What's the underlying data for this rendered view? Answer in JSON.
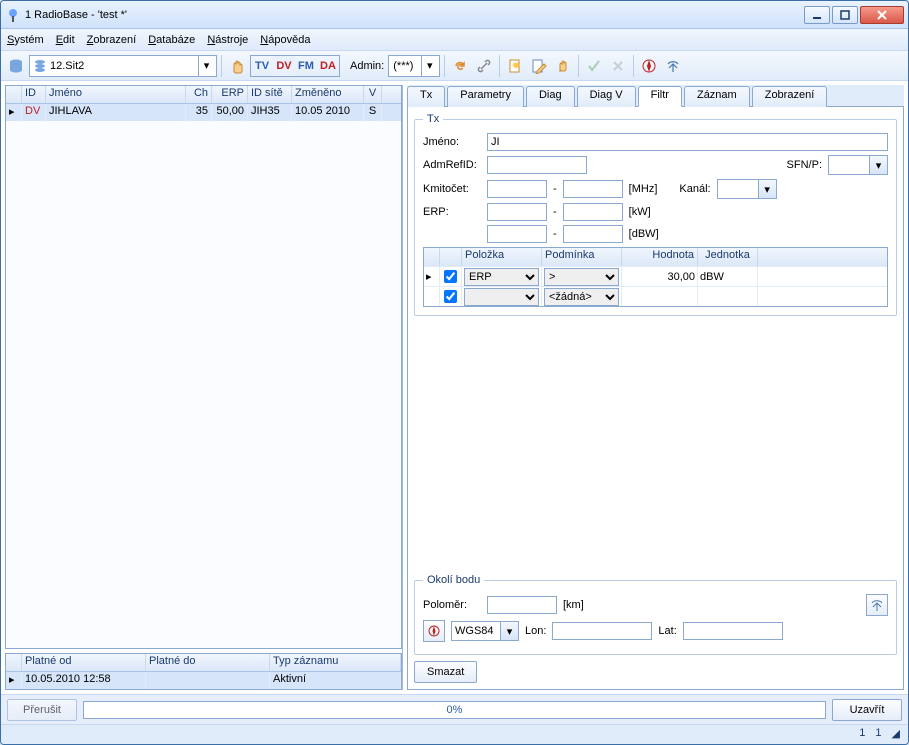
{
  "window": {
    "title": "1 RadioBase - 'test *'"
  },
  "menu": {
    "items": [
      "Systém",
      "Edit",
      "Zobrazení",
      "Databáze",
      "Nástroje",
      "Nápověda"
    ]
  },
  "toolbar": {
    "net_combo": "12.Sit2",
    "modes": {
      "tv": "TV",
      "dv": "DV",
      "fm": "FM",
      "da": "DA"
    },
    "admin_label": "Admin:",
    "admin_value": "(***)"
  },
  "left_grid": {
    "headers": {
      "id": "ID",
      "name": "Jméno",
      "ch": "Ch",
      "erp": "ERP",
      "site": "ID sítě",
      "changed": "Změněno",
      "v": "V"
    },
    "row": {
      "dv": "DV",
      "name": "JIHLAVA",
      "ch": "35",
      "erp": "50,00",
      "site": "JIH35",
      "changed": "10.05 2010",
      "v": "S"
    }
  },
  "bottom_grid": {
    "headers": {
      "from": "Platné od",
      "to": "Platné do",
      "type": "Typ záznamu"
    },
    "row": {
      "from": "10.05.2010 12:58",
      "to": "",
      "type": "Aktivní"
    }
  },
  "tabs": {
    "tx": "Tx",
    "params": "Parametry",
    "diag": "Diag",
    "diagv": "Diag V",
    "filtr": "Filtr",
    "record": "Záznam",
    "view": "Zobrazení"
  },
  "filter": {
    "tx_legend": "Tx",
    "name_label": "Jméno:",
    "name_value": "JI",
    "admrefid_label": "AdmRefID:",
    "sfnp_label": "SFN/P:",
    "freq_label": "Kmitočet:",
    "freq_unit": "[MHz]",
    "channel_label": "Kanál:",
    "erp_label": "ERP:",
    "erp_unit": "[kW]",
    "dbw_unit": "[dBW]",
    "dash": "-",
    "grid": {
      "headers": {
        "item": "Položka",
        "cond": "Podmínka",
        "value": "Hodnota",
        "unit": "Jednotka"
      },
      "rows": [
        {
          "checked": true,
          "item": "ERP",
          "cond": ">",
          "value": "30,00",
          "unit": "dBW"
        },
        {
          "checked": true,
          "item": "",
          "cond": "<žádná>",
          "value": "",
          "unit": ""
        }
      ]
    },
    "surround_legend": "Okolí bodu",
    "radius_label": "Poloměr:",
    "radius_unit": "[km]",
    "crs": "WGS84",
    "lon_label": "Lon:",
    "lat_label": "Lat:",
    "clear": "Smazat"
  },
  "footer": {
    "interrupt": "Přerušit",
    "progress": "0%",
    "close": "Uzavřít"
  },
  "status": {
    "a": "1",
    "b": "1"
  }
}
